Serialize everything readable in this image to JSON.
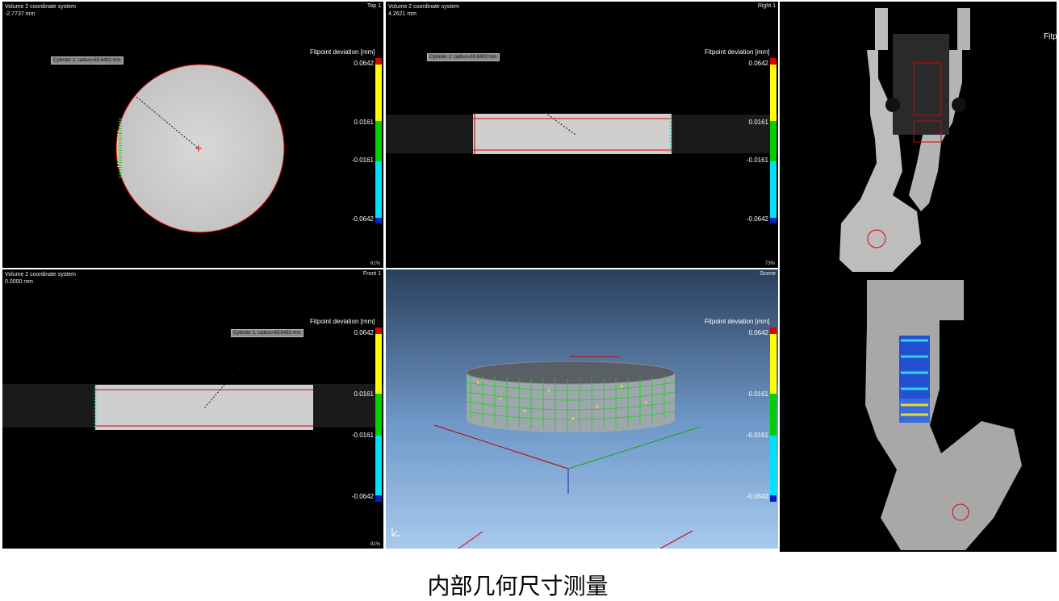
{
  "viewports": {
    "top": {
      "header_line1": "Volume 2 coordinate system",
      "header_line2": "-2.7737 mm",
      "name": "Top 1",
      "zoom": "61%",
      "callout": "Cylinder 1: radius=39.8483 mm"
    },
    "right": {
      "header_line1": "Volume 2 coordinate system",
      "header_line2": "4.2621 mm",
      "name": "Right 1",
      "zoom": "73%",
      "callout": "Cylinder 1: radius=39.8483 mm"
    },
    "front": {
      "header_line1": "Volume 2 coordinate system",
      "header_line2": "0.0000 mm",
      "name": "Front 1",
      "zoom": "81%",
      "callout": "Cylinder 1: radius=39.8483 mm"
    },
    "scene": {
      "name": "Scene"
    }
  },
  "fitpoint_scale": {
    "title": "Fitpoint deviation [mm]",
    "ticks": [
      "0.0642",
      "0.0161",
      "-0.0161",
      "-0.0642"
    ]
  },
  "side_panel": {
    "label": "Fitp"
  },
  "colors": {
    "red": "#e00000",
    "yellow": "#ffff00",
    "green": "#00d000",
    "cyan": "#00e0ff",
    "blue": "#0020c0"
  },
  "caption": "内部几何尺寸测量"
}
